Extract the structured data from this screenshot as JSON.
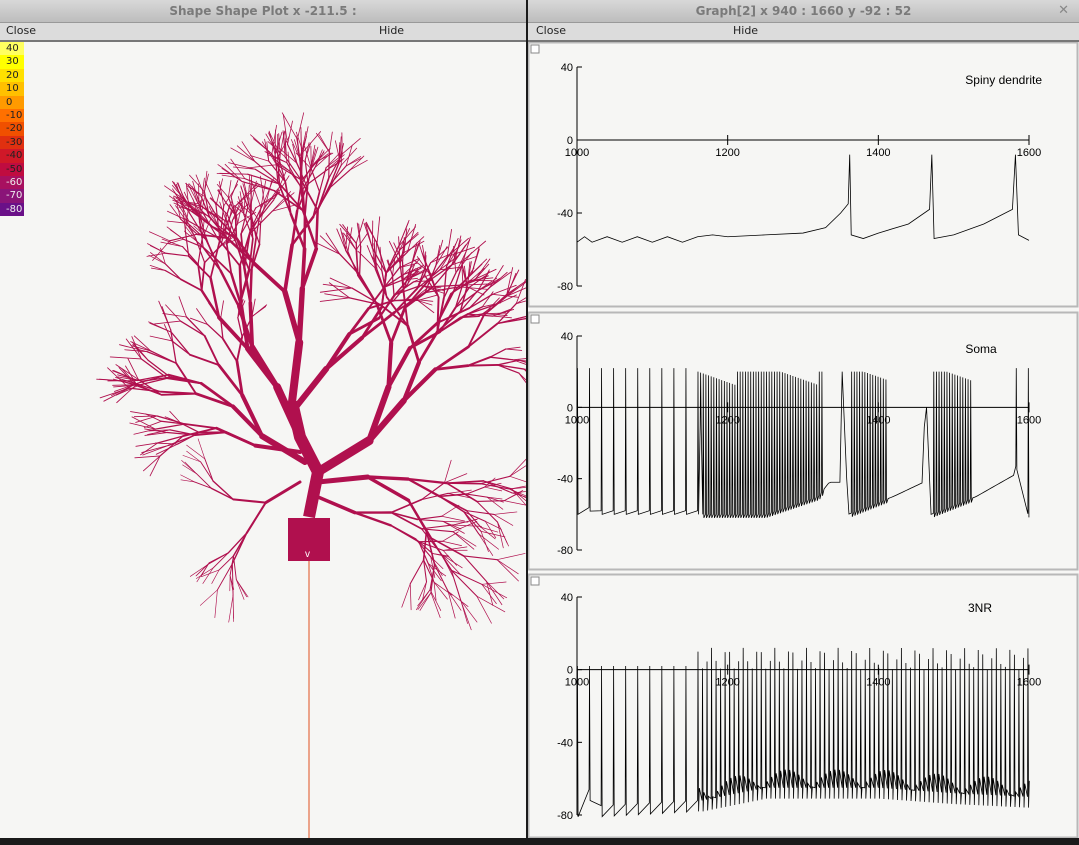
{
  "shape_window": {
    "title": "Shape Shape Plot x -211.5 :",
    "menu": {
      "close": "Close",
      "hide": "Hide"
    },
    "color_scale": [
      {
        "label": "40",
        "color": "#ffff60"
      },
      {
        "label": "30",
        "color": "#ffff00"
      },
      {
        "label": "20",
        "color": "#ffe000"
      },
      {
        "label": "10",
        "color": "#ffc000"
      },
      {
        "label": "0",
        "color": "#ff9a00"
      },
      {
        "label": "-10",
        "color": "#ff7000"
      },
      {
        "label": "-20",
        "color": "#f05000"
      },
      {
        "label": "-30",
        "color": "#e03010"
      },
      {
        "label": "-40",
        "color": "#d01828"
      },
      {
        "label": "-50",
        "color": "#c00c40"
      },
      {
        "label": "-60",
        "color": "#a81060"
      },
      {
        "label": "-70",
        "color": "#8a1478"
      },
      {
        "label": "-80",
        "color": "#6a1088"
      }
    ],
    "soma_label": "v",
    "neuron_color": "#b0104e",
    "axon_color": "#e05020"
  },
  "graph_window": {
    "title": "Graph[2]  x 940 : 1660  y -92 : 52",
    "menu": {
      "close": "Close",
      "hide": "Hide"
    },
    "close_glyph": "✕"
  },
  "chart_data": [
    {
      "type": "line",
      "title": "Spiny dendrite",
      "xlim": [
        1000,
        1600
      ],
      "ylim": [
        -80,
        40
      ],
      "x_ticks": [
        "1000",
        "1200",
        "1400",
        "1600"
      ],
      "y_ticks": [
        "40",
        "0",
        "-40",
        "-80"
      ],
      "series": [
        {
          "points": [
            [
              1000,
              -56
            ],
            [
              1010,
              -53
            ],
            [
              1020,
              -56
            ],
            [
              1040,
              -53
            ],
            [
              1060,
              -56
            ],
            [
              1080,
              -53
            ],
            [
              1100,
              -56
            ],
            [
              1120,
              -53
            ],
            [
              1140,
              -56
            ],
            [
              1160,
              -53
            ],
            [
              1180,
              -52
            ],
            [
              1200,
              -53
            ],
            [
              1250,
              -52
            ],
            [
              1300,
              -51
            ],
            [
              1330,
              -48
            ],
            [
              1350,
              -40
            ],
            [
              1360,
              -35
            ],
            [
              1362,
              -8
            ],
            [
              1364,
              -52
            ],
            [
              1380,
              -54
            ],
            [
              1400,
              -51
            ],
            [
              1440,
              -46
            ],
            [
              1468,
              -38
            ],
            [
              1471,
              -8
            ],
            [
              1474,
              -54
            ],
            [
              1500,
              -52
            ],
            [
              1540,
              -46
            ],
            [
              1578,
              -38
            ],
            [
              1582,
              -8
            ],
            [
              1586,
              -52
            ],
            [
              1600,
              -55
            ]
          ]
        }
      ]
    },
    {
      "type": "line",
      "title": "Soma",
      "xlim": [
        1000,
        1600
      ],
      "ylim": [
        -80,
        40
      ],
      "x_ticks": [
        "1000",
        "1200",
        "1400",
        "1600"
      ],
      "y_ticks": [
        "40",
        "0",
        "-40",
        "-80"
      ],
      "series": [
        {
          "points": [
            [
              1000,
              -58
            ],
            [
              1005,
              22
            ],
            [
              1010,
              -58
            ],
            [
              1020,
              -55
            ],
            [
              1022,
              22
            ],
            [
              1026,
              -58
            ],
            [
              1160,
              -58
            ],
            [
              1162,
              20
            ],
            [
              1166,
              -60
            ],
            [
              1250,
              -60
            ],
            [
              1320,
              -50
            ],
            [
              1335,
              -42
            ],
            [
              1350,
              -42
            ],
            [
              1352,
              20
            ],
            [
              1360,
              -60
            ],
            [
              1420,
              -50
            ],
            [
              1460,
              -42
            ],
            [
              1462,
              20
            ],
            [
              1470,
              -60
            ],
            [
              1530,
              -50
            ],
            [
              1580,
              -38
            ],
            [
              1585,
              -28
            ],
            [
              1590,
              -58
            ],
            [
              1600,
              -60
            ]
          ]
        }
      ]
    },
    {
      "type": "line",
      "title": "3NR",
      "xlim": [
        1000,
        1600
      ],
      "ylim": [
        -80,
        40
      ],
      "x_ticks": [
        "1000",
        "1200",
        "1400",
        "1600"
      ],
      "y_ticks": [
        "40",
        "0",
        "-40",
        "-80"
      ],
      "series": [
        {
          "points": [
            [
              1000,
              -75
            ],
            [
              1005,
              4
            ],
            [
              1010,
              -75
            ],
            [
              1020,
              -60
            ],
            [
              1022,
              4
            ],
            [
              1026,
              -75
            ],
            [
              1160,
              -72
            ],
            [
              1162,
              12
            ],
            [
              1166,
              -72
            ],
            [
              1250,
              -65
            ],
            [
              1400,
              -65
            ],
            [
              1500,
              -68
            ],
            [
              1600,
              -70
            ]
          ]
        }
      ]
    }
  ]
}
